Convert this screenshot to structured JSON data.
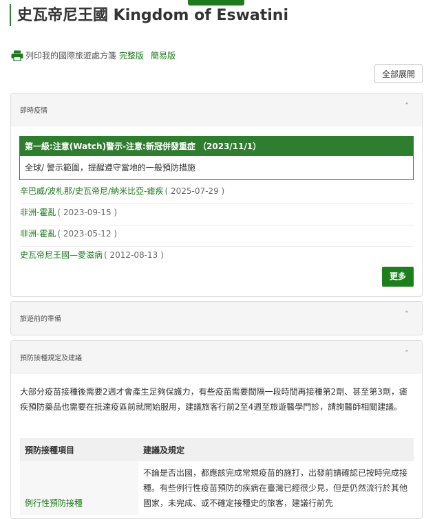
{
  "page": {
    "title": "史瓦帝尼王國 Kingdom of Eswatini",
    "print_label": "列印我的國際旅遊處方箋",
    "print_full": "完整版",
    "print_simple": "簡易版",
    "expand_all": "全部展開"
  },
  "panels": {
    "realtime": {
      "title": "即時疫情",
      "chevron": "ˆ",
      "alert": {
        "heading": "第一級:注意(Watch)警示-注意:新冠併發重症 （2023/11/1）",
        "body": "全球/ 警示範圍，提醒遵守當地的一般預防措施"
      },
      "notices": [
        {
          "title": "辛巴威/波札那/史瓦帝尼/納米比亞-瘧疾",
          "date": "( 2025-07-29 )"
        },
        {
          "title": "非洲-霍亂",
          "date": "( 2023-09-15 )"
        },
        {
          "title": "非洲-霍亂",
          "date": "( 2023-05-12 )"
        },
        {
          "title": "史瓦帝尼王國—愛滋病",
          "date": "( 2012-08-13 )"
        }
      ],
      "more": "更多"
    },
    "prep": {
      "title": "旅遊前的準備",
      "chevron": "ˇ"
    },
    "vaccine": {
      "title": "預防接種規定及建議",
      "chevron": "ˆ",
      "intro": "大部分疫苗接種後需要2週才會產生足夠保護力，有些疫苗需要間隔一段時間再接種第2劑、甚至第3劑，瘧疾預防藥品也需要在抵達疫區前就開始服用，建議旅客行前2至4週至旅遊醫學門診，請詢醫師相關建議。",
      "table": {
        "headers": [
          "預防接種項目",
          "建議及規定"
        ],
        "rows": [
          {
            "item": "例行性預防接種",
            "advice": "不論是否出國，都應該完成常規疫苗的施打，出發前請確認已按時完成接種。有些例行性疫苗預防的疾病在臺灣已經很少見，但是仍然流行於其他國家，未完成、或不確定接種史的旅客，建議行前先"
          }
        ]
      }
    }
  },
  "colors": {
    "brand_green": "#2f7d2f",
    "link_green": "#1b7a1b"
  }
}
